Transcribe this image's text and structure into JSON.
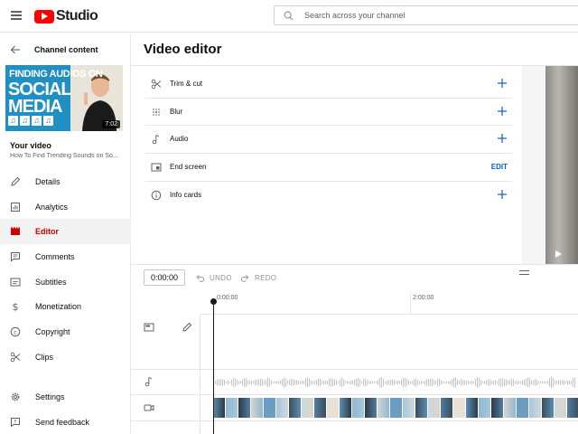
{
  "app": {
    "logo_text": "Studio",
    "search_placeholder": "Search across your channel"
  },
  "sidebar": {
    "back_label": "Channel content",
    "thumbnail": {
      "line1": "FINDING AUDIOS ON",
      "line2": "SOCIAL",
      "line3": "MEDIA",
      "duration": "7:02"
    },
    "your_video_label": "Your video",
    "video_title": "How To Find Trending Sounds on So...",
    "items": [
      {
        "label": "Details",
        "icon": "pencil-icon",
        "active": false
      },
      {
        "label": "Analytics",
        "icon": "analytics-icon",
        "active": false
      },
      {
        "label": "Editor",
        "icon": "editor-icon",
        "active": true
      },
      {
        "label": "Comments",
        "icon": "comments-icon",
        "active": false
      },
      {
        "label": "Subtitles",
        "icon": "subtitles-icon",
        "active": false
      },
      {
        "label": "Monetization",
        "icon": "dollar-icon",
        "active": false
      },
      {
        "label": "Copyright",
        "icon": "copyright-icon",
        "active": false
      },
      {
        "label": "Clips",
        "icon": "scissors-icon",
        "active": false
      }
    ],
    "bottom_items": [
      {
        "label": "Settings",
        "icon": "gear-icon"
      },
      {
        "label": "Send feedback",
        "icon": "feedback-icon"
      }
    ]
  },
  "editor": {
    "title": "Video editor",
    "tools": [
      {
        "label": "Trim & cut",
        "icon": "scissors-icon",
        "action": "add"
      },
      {
        "label": "Blur",
        "icon": "blur-icon",
        "action": "add"
      },
      {
        "label": "Audio",
        "icon": "music-note-icon",
        "action": "add"
      },
      {
        "label": "End screen",
        "icon": "end-screen-icon",
        "action": "EDIT"
      },
      {
        "label": "Info cards",
        "icon": "info-icon",
        "action": "add"
      }
    ],
    "time_value": "0:00:00",
    "undo_label": "UNDO",
    "redo_label": "REDO",
    "ruler": [
      "0:00:00",
      "2:00:00"
    ]
  },
  "colors": {
    "accent_blue": "#065fd4",
    "active_red": "#cc0000",
    "brand_red": "#ff0000"
  }
}
